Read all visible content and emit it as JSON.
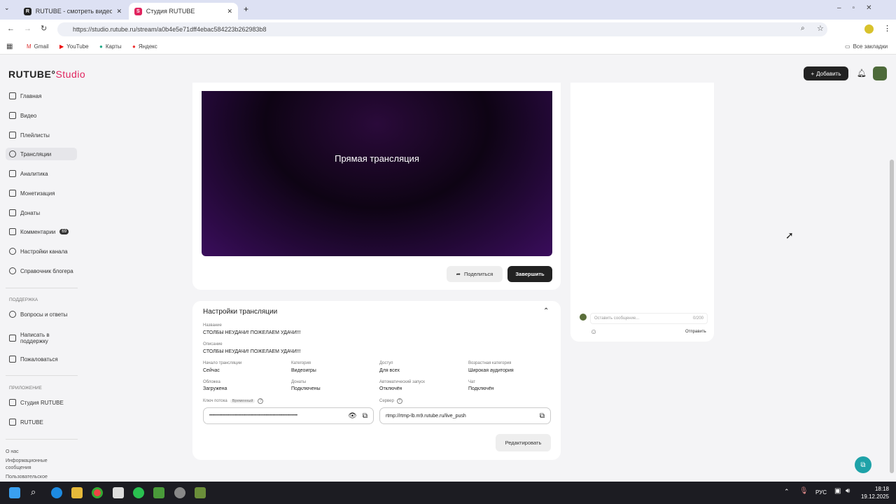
{
  "browser": {
    "tabs": [
      {
        "title": "RUTUBE - смотреть видео онл",
        "icon": "R"
      },
      {
        "title": "Студия RUTUBE",
        "icon": "S"
      }
    ],
    "url": "https://studio.rutube.ru/stream/a0b4e5e71dff4ebac584223b262983b8",
    "bookmarks": [
      "Gmail",
      "YouTube",
      "Карты",
      "Яндекс"
    ],
    "all_bookmarks": "Все закладки"
  },
  "header": {
    "logo_main": "RUTUBE",
    "logo_sub": "Studio",
    "add_label": "Добавить"
  },
  "sidebar": {
    "items": [
      {
        "label": "Главная"
      },
      {
        "label": "Видео"
      },
      {
        "label": "Плейлисты"
      },
      {
        "label": "Трансляции"
      },
      {
        "label": "Аналитика"
      },
      {
        "label": "Монетизация"
      },
      {
        "label": "Донаты"
      },
      {
        "label": "Комментарии",
        "badge": "69"
      },
      {
        "label": "Настройки канала"
      },
      {
        "label": "Справочник блогера"
      }
    ],
    "support_title": "ПОДДЕРЖКА",
    "support": [
      {
        "label": "Вопросы и ответы"
      },
      {
        "label": "Написать в поддержку"
      },
      {
        "label": "Пожаловаться"
      }
    ],
    "apps_title": "ПРИЛОЖЕНИЕ",
    "apps": [
      {
        "label": "Студия RUTUBE"
      },
      {
        "label": "RUTUBE"
      }
    ],
    "footer": [
      "О нас",
      "Информационные сообщения",
      "Пользовательское"
    ]
  },
  "player": {
    "overlay": "Прямая трансляция",
    "share": "Поделиться",
    "finish": "Завершить"
  },
  "settings": {
    "title": "Настройки трансляции",
    "name_label": "Название",
    "name": "СТОЛБЫ НЕУДАЧИ! ПОЖЕЛАЕМ УДАЧИ!!!",
    "desc_label": "Описание",
    "desc": "СТОЛБЫ НЕУДАЧИ! ПОЖЕЛАЕМ УДАЧИ!!!",
    "fields": [
      {
        "label": "Начало трансляции",
        "value": "Сейчас"
      },
      {
        "label": "Категория",
        "value": "Видеоигры"
      },
      {
        "label": "Доступ",
        "value": "Для всех"
      },
      {
        "label": "Возрастная категория",
        "value": "Широкая аудитория"
      },
      {
        "label": "Обложка",
        "value": "Загружена"
      },
      {
        "label": "Донаты",
        "value": "Подключены"
      },
      {
        "label": "Автоматический запуск",
        "value": "Отключён"
      },
      {
        "label": "Чат",
        "value": "Подключён"
      }
    ],
    "key_label": "Ключ потока",
    "key_badge": "Временный",
    "key_value": "••••••••••••••••••••••••••••••••••••••••••••••••••••••••••••",
    "server_label": "Сервер",
    "server_value": "rtmp://rtmp-lb.m9.rutube.ru/live_push",
    "edit": "Редактировать"
  },
  "chat": {
    "placeholder": "Оставить сообщение...",
    "counter": "0/200",
    "send": "Отправить"
  },
  "taskbar": {
    "lang": "РУС",
    "time": "18:18",
    "date": "19.12.2025"
  }
}
